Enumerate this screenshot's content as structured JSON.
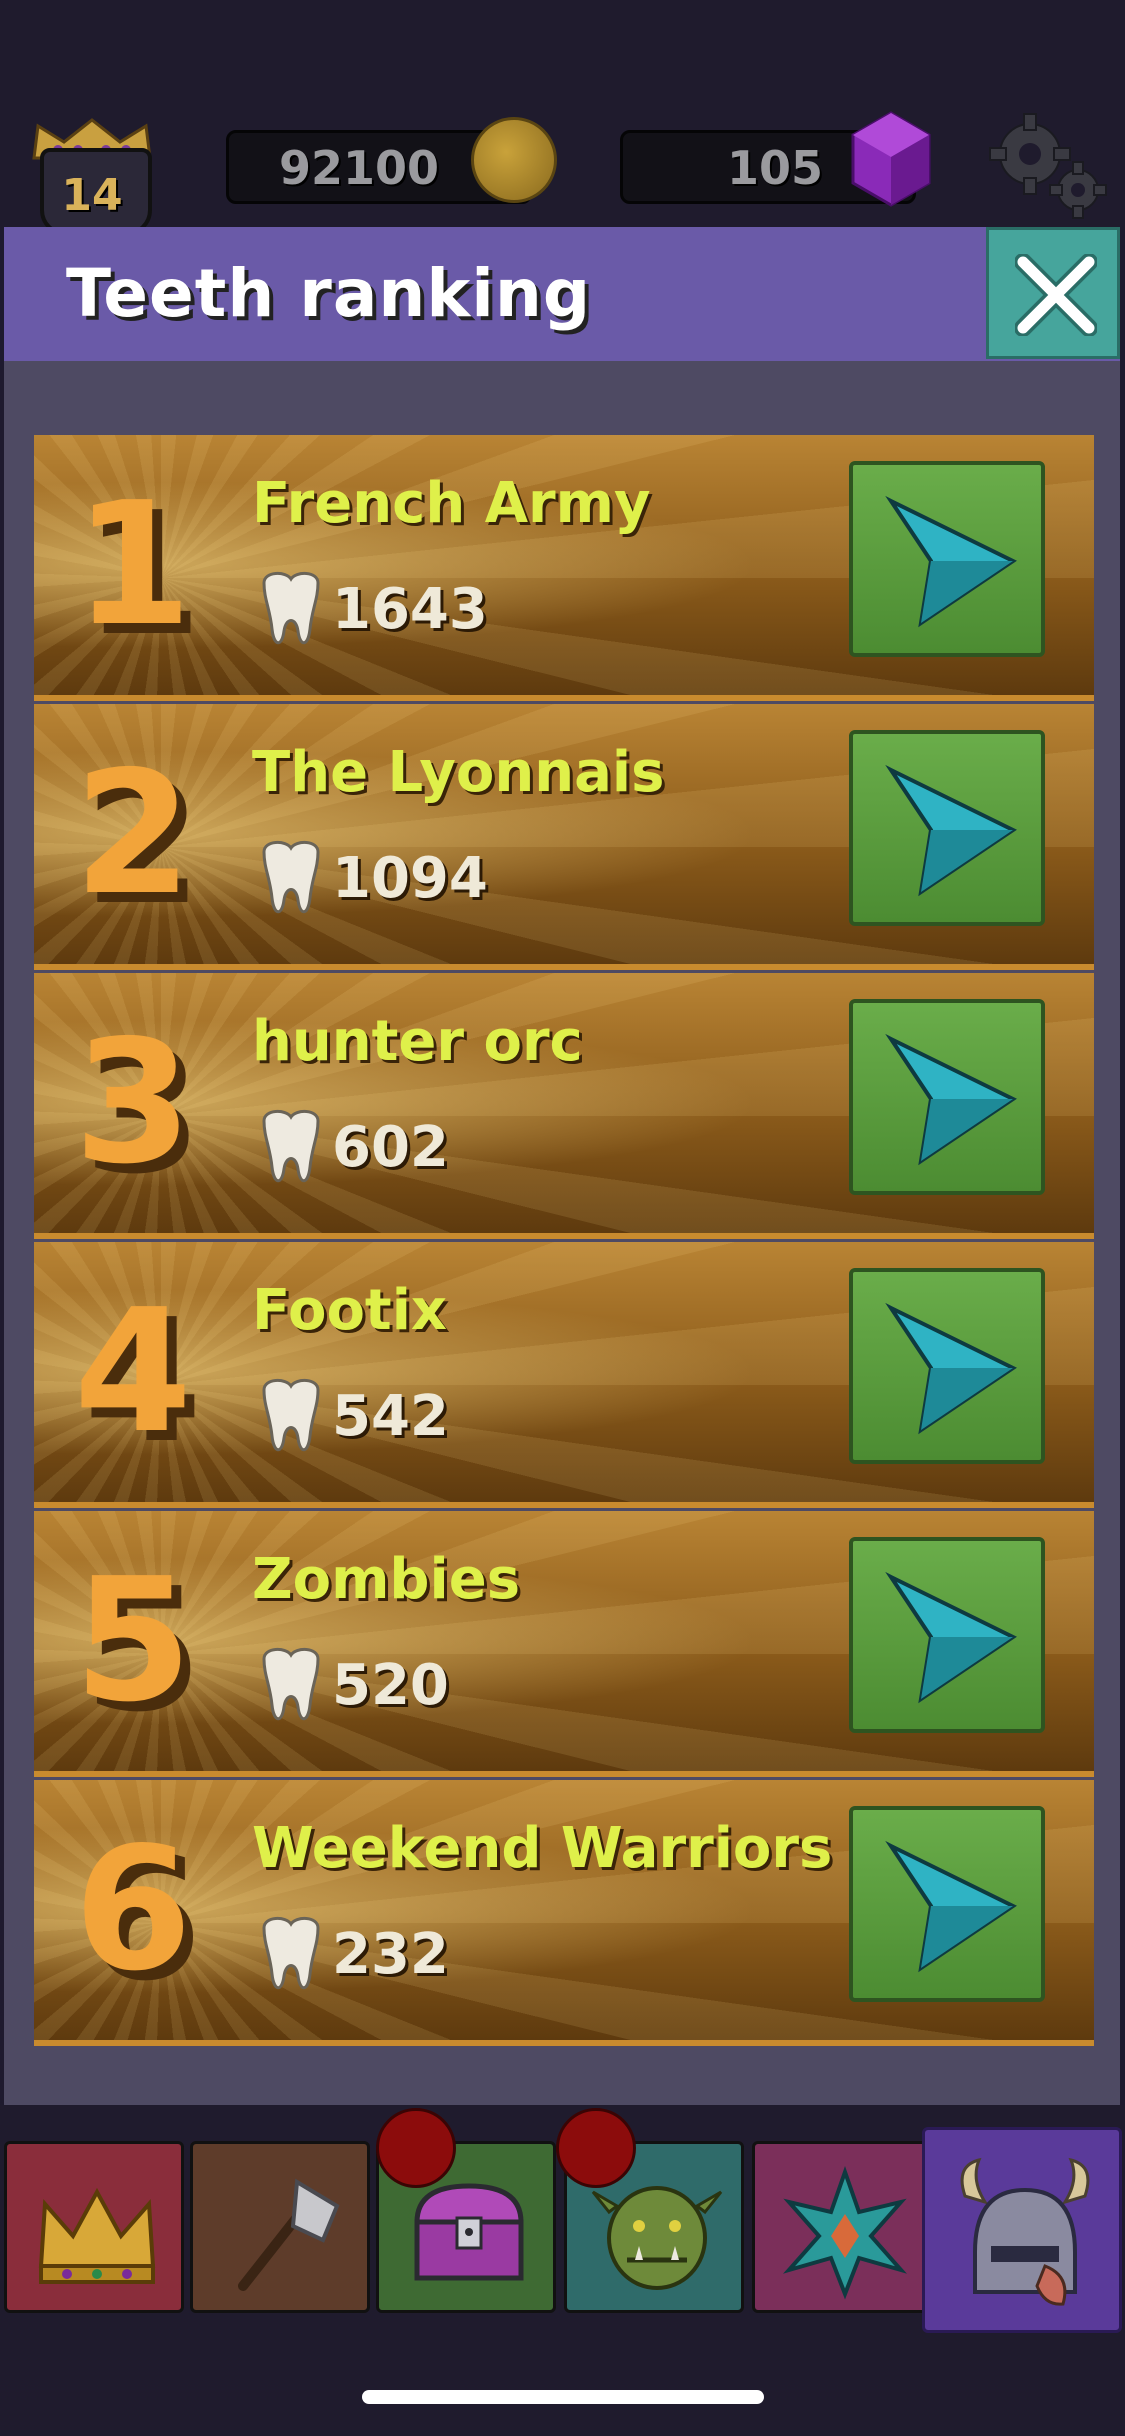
{
  "hud": {
    "level": "14",
    "coins": "92100",
    "gems": "105"
  },
  "panel": {
    "title": "Teeth ranking"
  },
  "ranking": [
    {
      "rank": "1",
      "name": "French Army",
      "teeth": "1643"
    },
    {
      "rank": "2",
      "name": "The Lyonnais",
      "teeth": "1094"
    },
    {
      "rank": "3",
      "name": "hunter orc",
      "teeth": "602"
    },
    {
      "rank": "4",
      "name": "Footix",
      "teeth": "542"
    },
    {
      "rank": "5",
      "name": "Zombies",
      "teeth": "520"
    },
    {
      "rank": "6",
      "name": "Weekend Warriors",
      "teeth": "232"
    }
  ],
  "nav": {
    "tabs": [
      "crown-icon",
      "axe-icon",
      "chest-icon",
      "orc-icon",
      "star-icon",
      "helmet-icon"
    ],
    "active_tab": "helmet-icon",
    "notifications_on": [
      "chest-icon",
      "orc-icon"
    ]
  },
  "colors": {
    "header": "#6a5aa8",
    "rank_name": "#dff04a",
    "rank_number": "#f2a43a",
    "play_button": "#5f9f42",
    "close_button": "#46a59c"
  }
}
